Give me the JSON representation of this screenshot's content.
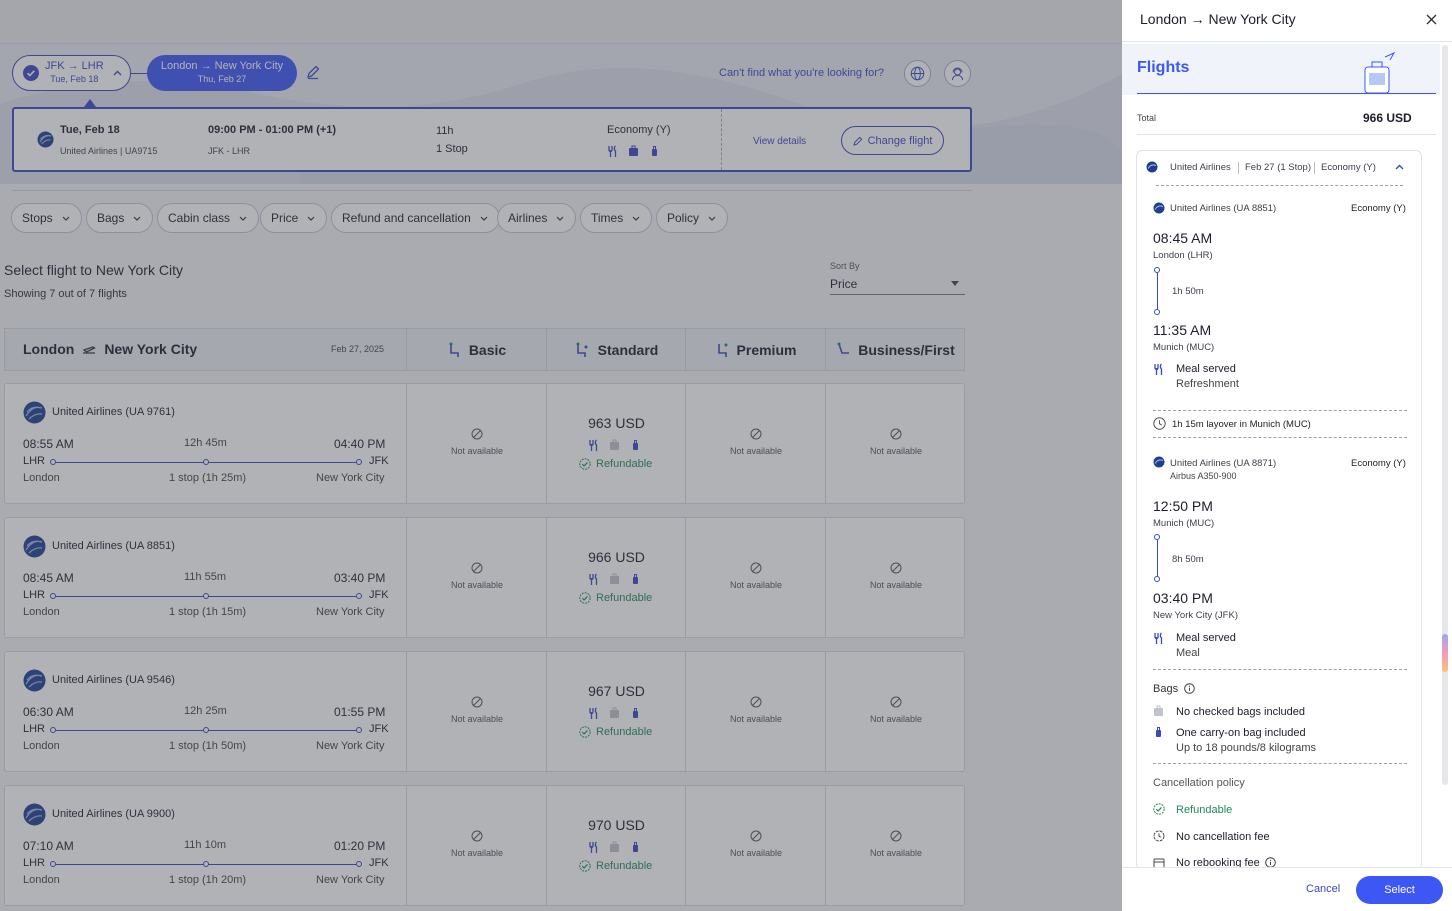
{
  "header": {
    "out_route": "JFK → LHR",
    "out_date": "Tue, Feb 18",
    "ret_route": "London → New York City",
    "ret_date": "Thu, Feb 27",
    "help_link": "Can't find what you're looking for?"
  },
  "selected_outbound": {
    "date": "Tue, Feb 18",
    "airline": "United Airlines | UA9715",
    "time": "09:00 PM - 01:00 PM (+1)",
    "route": "JFK - LHR",
    "duration": "11h",
    "stops": "1 Stop",
    "cabin": "Economy (Y)",
    "view_details": "View details",
    "change_flight": "Change flight"
  },
  "filters": [
    "Stops",
    "Bags",
    "Cabin class",
    "Price",
    "Refund and cancellation",
    "Airlines",
    "Times",
    "Policy"
  ],
  "results": {
    "title": "Select flight to New York City",
    "count": "Showing 7 out of 7 flights",
    "sort_label": "Sort By",
    "sort_value": "Price"
  },
  "table_header": {
    "origin": "London",
    "destination": "New York City",
    "date": "Feb 27, 2025",
    "fares": [
      "Basic",
      "Standard",
      "Premium",
      "Business/First"
    ]
  },
  "flights": [
    {
      "airline": "United Airlines (UA 9761)",
      "dep": "08:55 AM",
      "duration": "12h 45m",
      "arr": "04:40 PM",
      "from_code": "LHR",
      "to_code": "JFK",
      "from_city": "London",
      "stops": "1 stop (1h 25m)",
      "to_city": "New York City",
      "price": "963 USD",
      "refund": "Refundable",
      "na": "Not available"
    },
    {
      "airline": "United Airlines (UA 8851)",
      "dep": "08:45 AM",
      "duration": "11h 55m",
      "arr": "03:40 PM",
      "from_code": "LHR",
      "to_code": "JFK",
      "from_city": "London",
      "stops": "1 stop (1h 15m)",
      "to_city": "New York City",
      "price": "966 USD",
      "refund": "Refundable",
      "na": "Not available"
    },
    {
      "airline": "United Airlines (UA 9546)",
      "dep": "06:30 AM",
      "duration": "12h 25m",
      "arr": "01:55 PM",
      "from_code": "LHR",
      "to_code": "JFK",
      "from_city": "London",
      "stops": "1 stop (1h 50m)",
      "to_city": "New York City",
      "price": "967 USD",
      "refund": "Refundable",
      "na": "Not available"
    },
    {
      "airline": "United Airlines (UA 9900)",
      "dep": "07:10 AM",
      "duration": "11h 10m",
      "arr": "01:20 PM",
      "from_code": "LHR",
      "to_code": "JFK",
      "from_city": "London",
      "stops": "1 stop (1h 20m)",
      "to_city": "New York City",
      "price": "970 USD",
      "refund": "Refundable",
      "na": "Not available"
    }
  ],
  "panel": {
    "title": "London → New York City",
    "section": "Flights",
    "total_label": "Total",
    "total_value": "966 USD",
    "summary": {
      "airline": "United Airlines",
      "date": "Feb 27 (1 Stop)",
      "cabin": "Economy (Y)"
    },
    "seg1": {
      "airline": "United Airlines (UA 8851)",
      "cabin": "Economy (Y)",
      "dep_time": "08:45 AM",
      "dep_place": "London (LHR)",
      "duration": "1h 50m",
      "arr_time": "11:35 AM",
      "arr_place": "Munich (MUC)",
      "meal": "Meal served",
      "meal_type": "Refreshment"
    },
    "layover": "1h 15m layover in Munich (MUC)",
    "seg2": {
      "airline": "United Airlines (UA 8871)",
      "aircraft": "Airbus A350-900",
      "cabin": "Economy (Y)",
      "dep_time": "12:50 PM",
      "dep_place": "Munich (MUC)",
      "duration": "8h 50m",
      "arr_time": "03:40 PM",
      "arr_place": "New York City (JFK)",
      "meal": "Meal served",
      "meal_type": "Meal"
    },
    "bags_title": "Bags",
    "checked": "No checked bags included",
    "carry": "One carry-on bag included",
    "carry_detail": "Up to 18 pounds/8 kilograms",
    "policy_title": "Cancellation policy",
    "refundable": "Refundable",
    "no_cancel": "No cancellation fee",
    "no_rebook": "No rebooking fee",
    "cancel_btn": "Cancel",
    "select_btn": "Select"
  },
  "colors": {
    "primary": "#3d57f4",
    "link": "#3a48c4",
    "success": "#1f8a5b",
    "overlay": "rgba(70,72,82,0.42)"
  }
}
